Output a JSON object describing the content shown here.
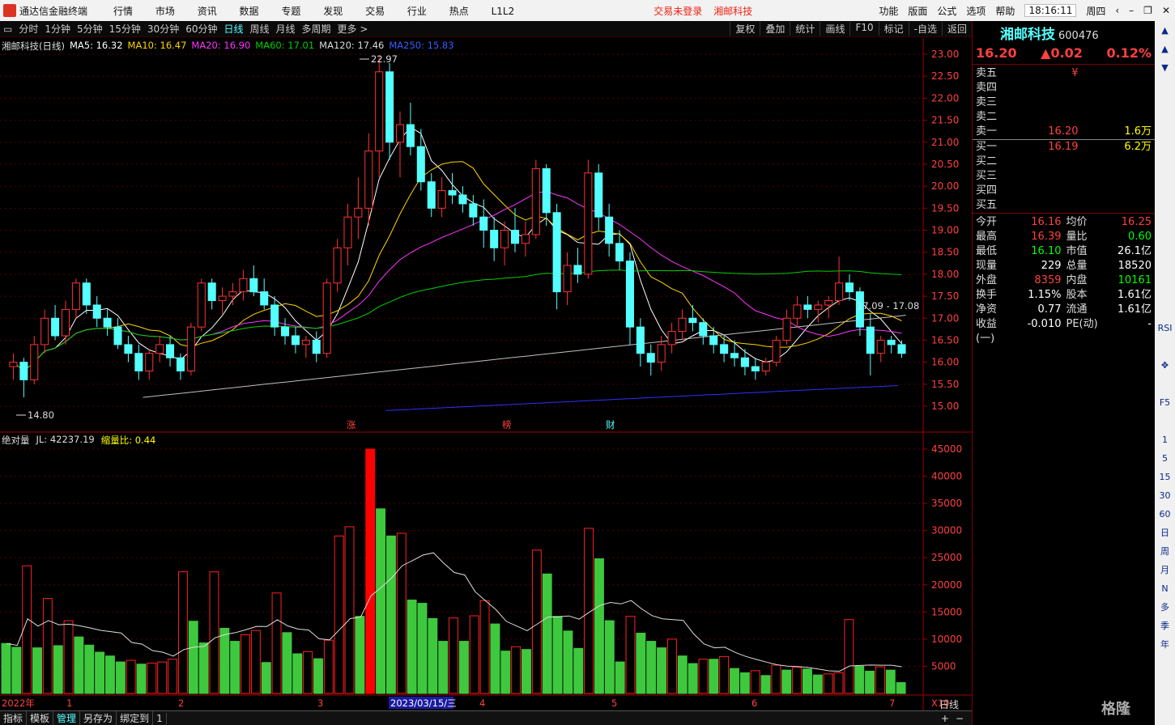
{
  "titlebar": {
    "app_name": "通达信金融终端",
    "menu": [
      "行情",
      "市场",
      "资讯",
      "数据",
      "专题",
      "发现",
      "交易",
      "行业",
      "热点",
      "L1L2"
    ],
    "trade_status": "交易未登录",
    "stock_name": "湘邮科技",
    "right_menu": [
      "功能",
      "版面",
      "公式",
      "选项",
      "帮助"
    ],
    "clock": "18:16:11",
    "weekday": "周四"
  },
  "toolbar": {
    "periods": [
      "分时",
      "1分钟",
      "5分钟",
      "15分钟",
      "30分钟",
      "60分钟",
      "日线",
      "周线",
      "月线",
      "多周期",
      "更多 >"
    ],
    "active_period": "日线",
    "right_buttons": [
      "复权",
      "叠加",
      "统计",
      "画线",
      "F10",
      "标记",
      "-自选",
      "返回"
    ]
  },
  "chart_header": {
    "name": "湘邮科技(日线)",
    "ma5": "MA5: 16.32",
    "ma10": "MA10: 16.47",
    "ma20": "MA20: 16.90",
    "ma60": "MA60: 17.01",
    "ma120": "MA120: 17.46",
    "ma250": "MA250: 15.83"
  },
  "volume_header": {
    "name": "绝对量",
    "jl": "JL: 42237.19",
    "ratio": "缩量比: 0.44"
  },
  "chart_data": [
    {
      "type": "candlestick",
      "title": "湘邮科技(日线)",
      "ylim": [
        15.0,
        23.0
      ],
      "y_ticks": [
        "23.00",
        "22.50",
        "22.00",
        "21.50",
        "21.00",
        "20.50",
        "20.00",
        "19.50",
        "19.00",
        "18.50",
        "18.00",
        "17.50",
        "17.00",
        "16.50",
        "16.00",
        "15.50",
        "15.00"
      ],
      "annotations": [
        "22.97",
        "14.80",
        "17.09 - 17.08",
        "涨",
        "榜",
        "财"
      ],
      "ohlc": [
        [
          15.9,
          16.2,
          15.6,
          16.0
        ],
        [
          16.0,
          16.1,
          15.2,
          15.6
        ],
        [
          15.6,
          16.6,
          15.5,
          16.4
        ],
        [
          16.4,
          17.2,
          16.2,
          17.0
        ],
        [
          17.0,
          17.3,
          16.5,
          16.6
        ],
        [
          16.6,
          17.4,
          16.4,
          17.2
        ],
        [
          17.2,
          17.9,
          17.0,
          17.8
        ],
        [
          17.8,
          17.9,
          17.1,
          17.3
        ],
        [
          17.3,
          17.5,
          16.8,
          17.0
        ],
        [
          17.0,
          17.2,
          16.6,
          16.8
        ],
        [
          16.8,
          17.0,
          16.3,
          16.4
        ],
        [
          16.4,
          16.6,
          16.0,
          16.2
        ],
        [
          16.2,
          16.4,
          15.6,
          15.8
        ],
        [
          15.8,
          16.3,
          15.6,
          16.2
        ],
        [
          16.2,
          16.6,
          16.0,
          16.4
        ],
        [
          16.4,
          16.6,
          15.9,
          16.1
        ],
        [
          16.1,
          16.2,
          15.6,
          15.8
        ],
        [
          15.8,
          16.9,
          15.7,
          16.8
        ],
        [
          16.8,
          17.9,
          16.7,
          17.8
        ],
        [
          17.8,
          17.9,
          17.2,
          17.4
        ],
        [
          17.4,
          17.7,
          17.1,
          17.5
        ],
        [
          17.5,
          17.8,
          17.3,
          17.6
        ],
        [
          17.6,
          18.1,
          17.4,
          17.9
        ],
        [
          17.9,
          18.2,
          17.5,
          17.6
        ],
        [
          17.6,
          17.9,
          17.2,
          17.3
        ],
        [
          17.3,
          17.5,
          16.6,
          16.8
        ],
        [
          16.8,
          17.0,
          16.4,
          16.6
        ],
        [
          16.6,
          16.8,
          16.2,
          16.4
        ],
        [
          16.4,
          16.6,
          16.1,
          16.5
        ],
        [
          16.5,
          16.7,
          16.0,
          16.2
        ],
        [
          16.2,
          17.9,
          16.1,
          17.8
        ],
        [
          17.8,
          18.8,
          17.6,
          18.6
        ],
        [
          18.6,
          19.6,
          18.2,
          19.3
        ],
        [
          19.3,
          20.2,
          18.8,
          19.5
        ],
        [
          19.5,
          21.2,
          19.1,
          20.8
        ],
        [
          20.8,
          22.97,
          20.2,
          22.6
        ],
        [
          22.6,
          22.8,
          20.6,
          21.0
        ],
        [
          21.0,
          21.7,
          20.2,
          21.4
        ],
        [
          21.4,
          21.9,
          20.7,
          20.9
        ],
        [
          20.9,
          21.3,
          19.9,
          20.1
        ],
        [
          20.1,
          20.3,
          19.3,
          19.5
        ],
        [
          19.5,
          20.2,
          19.3,
          19.9
        ],
        [
          19.9,
          20.3,
          19.6,
          19.8
        ],
        [
          19.8,
          20.0,
          19.4,
          19.6
        ],
        [
          19.6,
          19.8,
          19.1,
          19.3
        ],
        [
          19.3,
          19.7,
          18.6,
          19.0
        ],
        [
          19.0,
          19.3,
          18.3,
          18.6
        ],
        [
          18.6,
          19.2,
          18.2,
          19.0
        ],
        [
          19.0,
          19.5,
          18.5,
          18.7
        ],
        [
          18.7,
          19.2,
          18.4,
          18.9
        ],
        [
          18.9,
          20.6,
          18.8,
          20.4
        ],
        [
          20.4,
          20.5,
          19.1,
          19.4
        ],
        [
          19.4,
          19.6,
          17.2,
          17.6
        ],
        [
          17.6,
          18.5,
          17.3,
          18.2
        ],
        [
          18.2,
          18.6,
          17.8,
          18.0
        ],
        [
          18.0,
          20.6,
          17.9,
          20.3
        ],
        [
          20.3,
          20.5,
          19.0,
          19.3
        ],
        [
          19.3,
          19.6,
          18.4,
          18.7
        ],
        [
          18.7,
          19.0,
          18.1,
          18.3
        ],
        [
          18.3,
          18.5,
          16.4,
          16.8
        ],
        [
          16.8,
          17.0,
          15.9,
          16.2
        ],
        [
          16.2,
          16.4,
          15.7,
          16.0
        ],
        [
          16.0,
          16.6,
          15.8,
          16.4
        ],
        [
          16.4,
          16.9,
          16.2,
          16.7
        ],
        [
          16.7,
          17.2,
          16.5,
          17.0
        ],
        [
          17.0,
          17.3,
          16.7,
          16.9
        ],
        [
          16.9,
          17.0,
          16.4,
          16.6
        ],
        [
          16.6,
          16.8,
          16.2,
          16.4
        ],
        [
          16.4,
          16.6,
          16.0,
          16.2
        ],
        [
          16.2,
          16.5,
          15.9,
          16.1
        ],
        [
          16.1,
          16.3,
          15.7,
          15.9
        ],
        [
          15.9,
          16.1,
          15.6,
          15.8
        ],
        [
          15.8,
          16.1,
          15.7,
          16.0
        ],
        [
          16.0,
          16.6,
          15.9,
          16.5
        ],
        [
          16.5,
          17.2,
          16.4,
          17.0
        ],
        [
          17.0,
          17.5,
          16.8,
          17.3
        ],
        [
          17.3,
          17.5,
          17.0,
          17.2
        ],
        [
          17.2,
          17.4,
          16.9,
          17.3
        ],
        [
          17.3,
          17.5,
          17.0,
          17.4
        ],
        [
          17.4,
          18.4,
          17.3,
          17.8
        ],
        [
          17.8,
          18.0,
          17.4,
          17.6
        ],
        [
          17.6,
          17.7,
          16.6,
          16.8
        ],
        [
          16.8,
          17.1,
          15.7,
          16.2
        ],
        [
          16.2,
          16.6,
          16.0,
          16.5
        ],
        [
          16.5,
          16.6,
          16.2,
          16.4
        ],
        [
          16.4,
          16.5,
          16.1,
          16.2
        ]
      ]
    },
    {
      "type": "bar",
      "title": "绝对量",
      "ylim": [
        0,
        45000
      ],
      "y_ticks": [
        "45000",
        "40000",
        "35000",
        "30000",
        "25000",
        "20000",
        "15000",
        "10000",
        "5000"
      ],
      "x_tick_labels": [
        "2022年",
        "1",
        "2",
        "3",
        "2023/03/15/三",
        "4",
        "5",
        "6",
        "7",
        "X10"
      ],
      "values": [
        9200,
        8500,
        23500,
        8400,
        17500,
        8800,
        13400,
        10400,
        8900,
        7600,
        6900,
        5800,
        6100,
        5400,
        5600,
        5800,
        6300,
        22400,
        13300,
        9300,
        22400,
        12000,
        9600,
        10800,
        11600,
        5700,
        18500,
        11200,
        7300,
        7700,
        6400,
        9800,
        29000,
        30700,
        14200,
        45000,
        34000,
        29000,
        29500,
        17200,
        16600,
        13800,
        9600,
        13900,
        9600,
        14300,
        17100,
        12800,
        7800,
        8600,
        8100,
        26400,
        22000,
        14200,
        11500,
        8300,
        30400,
        24800,
        13400,
        5800,
        14200,
        11100,
        9600,
        8400,
        10000,
        6900,
        5500,
        6300,
        6300,
        6800,
        4600,
        3800,
        4200,
        3300,
        5200,
        4300,
        4800,
        4500,
        3400,
        3600,
        3800,
        13600,
        5000,
        4100,
        4900,
        4300,
        2000
      ],
      "series": [
        {
          "name": "放量",
          "color": "#ff0000"
        },
        {
          "name": "缩量",
          "color": "#3ec83e"
        }
      ]
    }
  ],
  "sidebar": {
    "name": "湘邮科技",
    "code": "600476",
    "price": "16.20",
    "change": "▲0.02",
    "pct": "0.12%",
    "asks": [
      [
        "卖五",
        "¥",
        ""
      ],
      [
        "卖四",
        "",
        ""
      ],
      [
        "卖三",
        "",
        ""
      ],
      [
        "卖二",
        "",
        ""
      ],
      [
        "卖一",
        "16.20",
        "1.6万"
      ]
    ],
    "bids": [
      [
        "买一",
        "16.19",
        "6.2万"
      ],
      [
        "买二",
        "",
        ""
      ],
      [
        "买三",
        "",
        ""
      ],
      [
        "买四",
        "",
        ""
      ],
      [
        "买五",
        "",
        ""
      ]
    ],
    "stats": [
      [
        "今开",
        "16.16",
        "均价",
        "16.25"
      ],
      [
        "最高",
        "16.39",
        "量比",
        "0.60"
      ],
      [
        "最低",
        "16.10",
        "市值",
        "26.1亿"
      ],
      [
        "现量",
        "229",
        "总量",
        "18520"
      ],
      [
        "外盘",
        "8359",
        "内盘",
        "10161"
      ],
      [
        "换手",
        "1.15%",
        "股本",
        "1.61亿"
      ],
      [
        "净资",
        "0.77",
        "流通",
        "1.61亿"
      ],
      [
        "收益(一)",
        "-0.010",
        "PE(动)",
        "-"
      ]
    ]
  },
  "rightbar": [
    "▲",
    "▲",
    "▼",
    "",
    "",
    "",
    "",
    "",
    "",
    "",
    "",
    "",
    "",
    "",
    "",
    "",
    "RSI",
    "",
    "✥",
    "",
    "F5",
    "",
    "1",
    "5",
    "15",
    "30",
    "60",
    "日",
    "周",
    "月",
    "N",
    "多",
    "季",
    "年"
  ],
  "bottombar": {
    "tabs": [
      "指标",
      "模板",
      "管理",
      "另存为",
      "绑定到",
      "1"
    ],
    "right": "日线",
    "period_label": "日线"
  },
  "colors": {
    "up": "#ff3232",
    "down": "#54ffff",
    "ma5": "#ffffff",
    "ma10": "#ffd400",
    "ma20": "#ff33ff",
    "ma60": "#00d000",
    "ma120": "#c0c0c0",
    "ma250": "#3030ff"
  },
  "watermark": "格隆"
}
